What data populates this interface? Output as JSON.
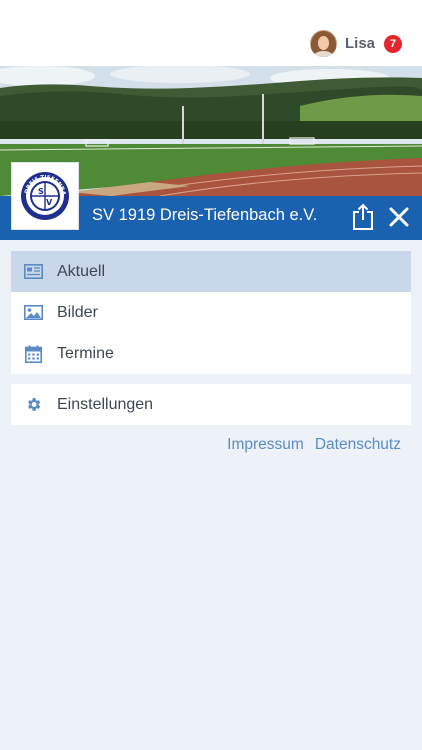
{
  "user": {
    "name": "Lisa",
    "notifications": "7"
  },
  "club": {
    "name": "SV 1919 Dreis-Tiefenbach e.V.",
    "logo_text": "DREIS-TIEFENBACH",
    "logo_initials": [
      "S",
      "V"
    ]
  },
  "menu": {
    "items": [
      {
        "label": "Aktuell",
        "icon": "newspaper-icon",
        "active": true
      },
      {
        "label": "Bilder",
        "icon": "image-icon",
        "active": false
      },
      {
        "label": "Termine",
        "icon": "calendar-icon",
        "active": false
      }
    ],
    "settings": {
      "label": "Einstellungen",
      "icon": "gear-icon"
    }
  },
  "footer": {
    "impressum": "Impressum",
    "datenschutz": "Datenschutz"
  },
  "colors": {
    "brand_blue": "#1a61b0",
    "active_item": "#c8d8ea",
    "link": "#5a8cc6",
    "badge": "#e5262c",
    "background": "#edf1f8"
  }
}
